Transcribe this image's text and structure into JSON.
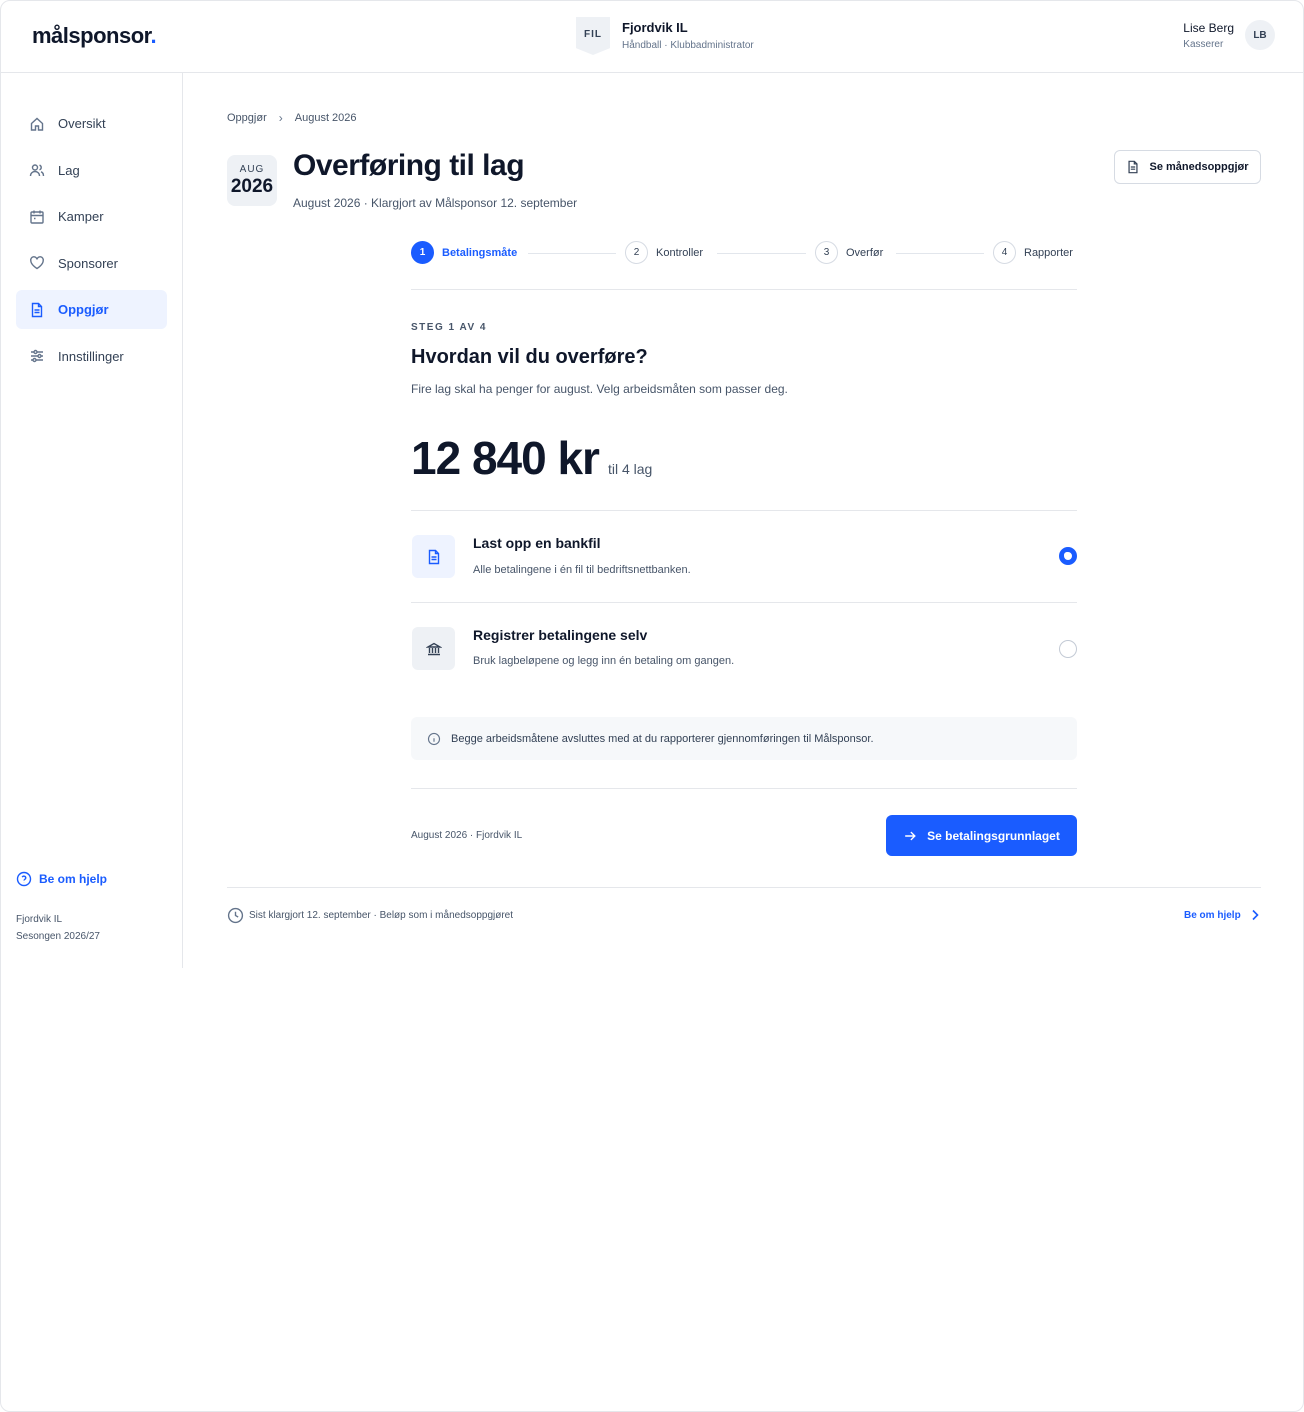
{
  "brand": {
    "logo_text": "målsponsor",
    "logo_dot": ".",
    "accent": "#1a5cff"
  },
  "club": {
    "badge": "FIL",
    "name": "Fjordvik IL",
    "subtitle": "Håndball · Klubbadministrator"
  },
  "user": {
    "name": "Lise Berg",
    "role": "Kasserer",
    "initials": "LB"
  },
  "sidebar": {
    "items": [
      {
        "label": "Oversikt",
        "icon": "home-icon"
      },
      {
        "label": "Lag",
        "icon": "users-icon"
      },
      {
        "label": "Kamper",
        "icon": "calendar-icon"
      },
      {
        "label": "Sponsorer",
        "icon": "heart-icon"
      },
      {
        "label": "Oppgjør",
        "icon": "document-icon",
        "active": true
      },
      {
        "label": "Innstillinger",
        "icon": "sliders-icon"
      }
    ],
    "help_label": "Be om hjelp",
    "footer_club": "Fjordvik IL",
    "footer_season": "Sesongen 2026/27"
  },
  "breadcrumb": {
    "parent": "Oppgjør",
    "current": "August 2026"
  },
  "date_chip": {
    "month": "AUG",
    "year": "2026"
  },
  "page": {
    "title": "Overføring til lag",
    "subtitle": "August 2026 · Klargjort av Målsponsor 12. september",
    "month_button": "Se månedsoppgjør"
  },
  "stepper": {
    "steps": [
      {
        "num": "1",
        "label": "Betalingsmåte",
        "active": true
      },
      {
        "num": "2",
        "label": "Kontroller"
      },
      {
        "num": "3",
        "label": "Overfør"
      },
      {
        "num": "4",
        "label": "Rapporter"
      }
    ]
  },
  "step_content": {
    "tag": "STEG 1 AV 4",
    "title": "Hvordan vil du overføre?",
    "subtitle": "Fire lag skal ha penger for august. Velg arbeidsmåten som passer deg.",
    "amount": "12 840 kr",
    "amount_suffix": "til 4 lag"
  },
  "options": [
    {
      "title": "Last opp en bankfil",
      "desc": "Alle betalingene i én fil til bedriftsnettbanken.",
      "icon": "file-icon",
      "selected": true
    },
    {
      "title": "Registrer betalingene selv",
      "desc": "Bruk lagbeløpene og legg inn én betaling om gangen.",
      "icon": "bank-icon",
      "selected": false
    }
  ],
  "info_text": "Begge arbeidsmåtene avsluttes med at du rapporterer gjennomføringen til Målsponsor.",
  "form_footer": "August 2026 · Fjordvik IL",
  "primary_button": "Se betalingsgrunnlaget",
  "page_footer": {
    "status": "Sist klargjort 12. september · Beløp som i månedsoppgjøret",
    "help": "Be om hjelp"
  }
}
